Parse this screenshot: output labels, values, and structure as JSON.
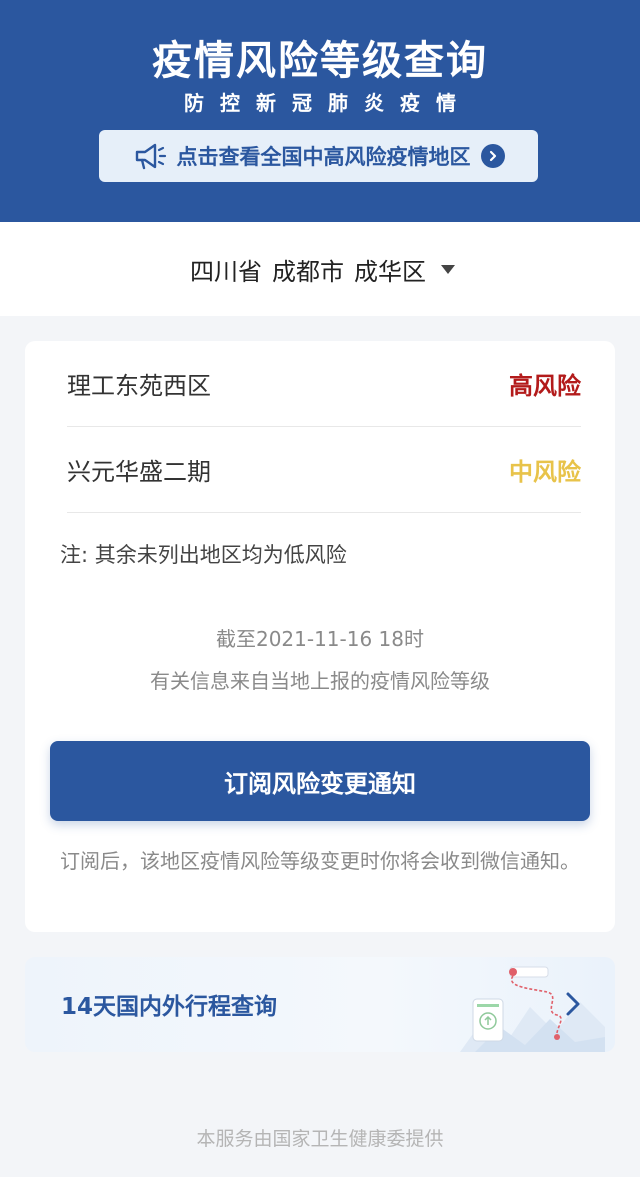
{
  "header": {
    "title": "疫情风险等级查询",
    "subtitle": "防控新冠肺炎疫情",
    "banner_text": "点击查看全国中高风险疫情地区",
    "color": "#2b579f"
  },
  "location": {
    "province": "四川省",
    "city": "成都市",
    "district": "成华区"
  },
  "risk_areas": [
    {
      "area": "理工东苑西区",
      "level": "高风险",
      "color": "#b31b1b"
    },
    {
      "area": "兴元华盛二期",
      "level": "中风险",
      "color": "#e8c34a"
    }
  ],
  "note": "注: 其余未列出地区均为低风险",
  "update_time": "截至2021-11-16 18时",
  "source_info": "有关信息来自当地上报的疫情风险等级",
  "subscribe": {
    "button_label": "订阅风险变更通知",
    "note": "订阅后，该地区疫情风险等级变更时你将会收到微信通知。"
  },
  "trip": {
    "label": "14天国内外行程查询"
  },
  "footer": "本服务由国家卫生健康委提供"
}
